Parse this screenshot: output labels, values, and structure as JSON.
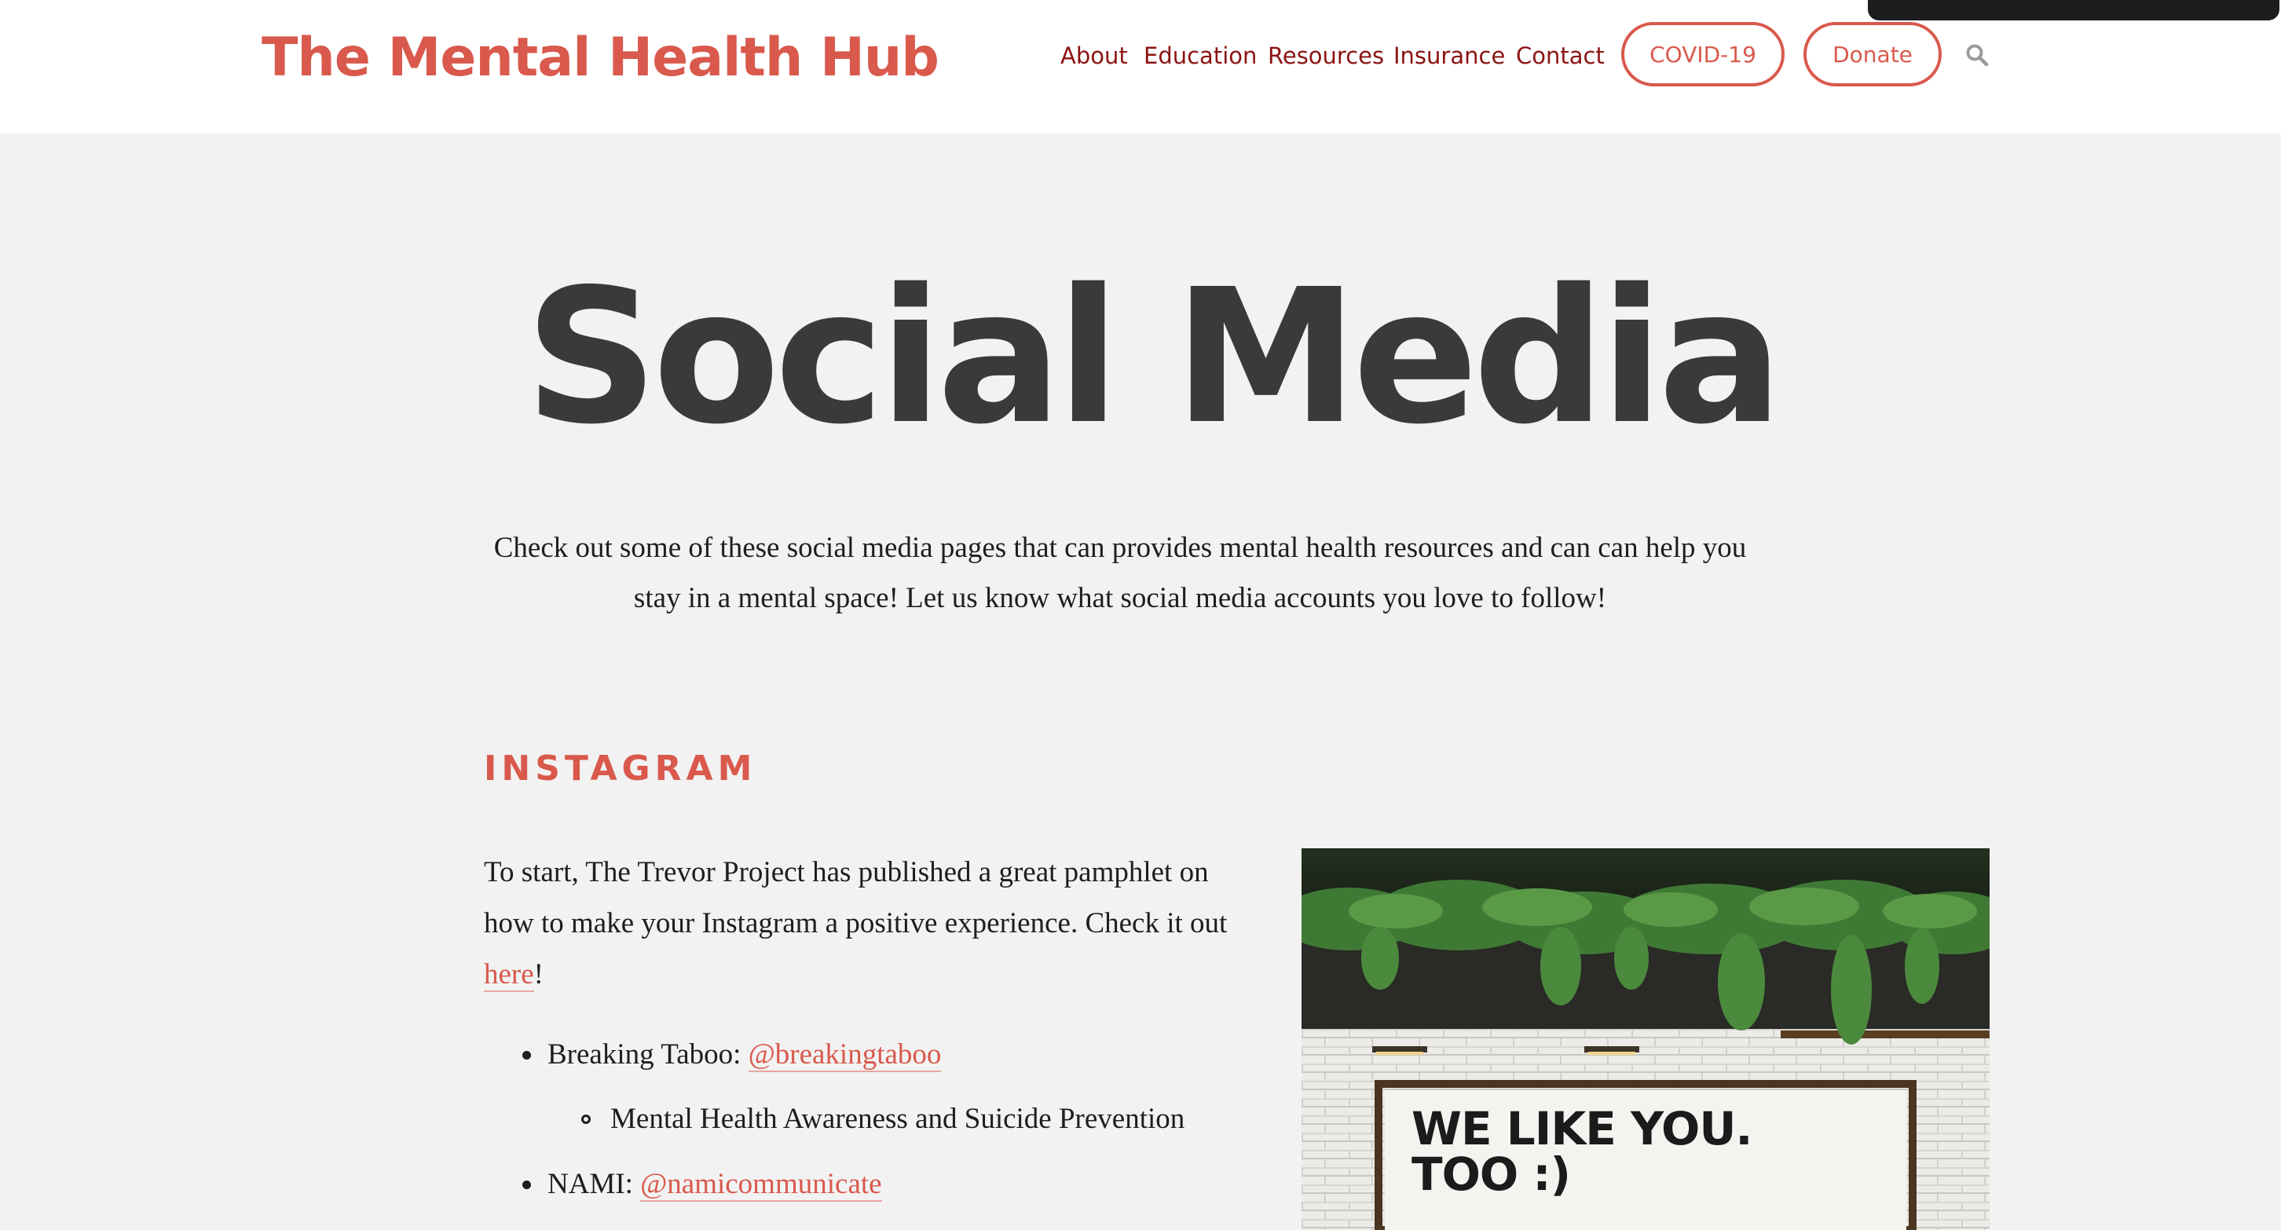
{
  "header": {
    "site_title": "The Mental Health Hub",
    "nav": {
      "about": "About",
      "education": "Education",
      "resources": "Resources",
      "insurance": "Insurance",
      "contact": "Contact"
    },
    "covid_button": "COVID-19",
    "donate_button": "Donate",
    "search_icon": "search-icon"
  },
  "hero": {
    "title": "Social Media"
  },
  "intro": {
    "text": "Check out some of these social media pages that can provides mental health resources and can can help you stay in a mental space! Let us know what social media accounts you love to follow!"
  },
  "instagram": {
    "heading": "INSTAGRAM",
    "text_before": "To start, The Trevor Project has published a great pamphlet on how to make your Instagram a positive experience. Check it out ",
    "here_link": "here",
    "text_after": "!",
    "items": [
      {
        "label": "Breaking Taboo: ",
        "handle": "@breakingtaboo",
        "sub_item": "Mental Health Awareness and Suicide Prevention"
      },
      {
        "label": "NAMI: ",
        "handle": "@namicommunicate"
      }
    ],
    "photo": {
      "sign_text": "WE LIKE YOU.\nTOO :)"
    }
  },
  "colors": {
    "accent": "#d9594c",
    "nav": "#8c1313",
    "background": "#f2f2f2",
    "heading": "#3a3a3a"
  }
}
